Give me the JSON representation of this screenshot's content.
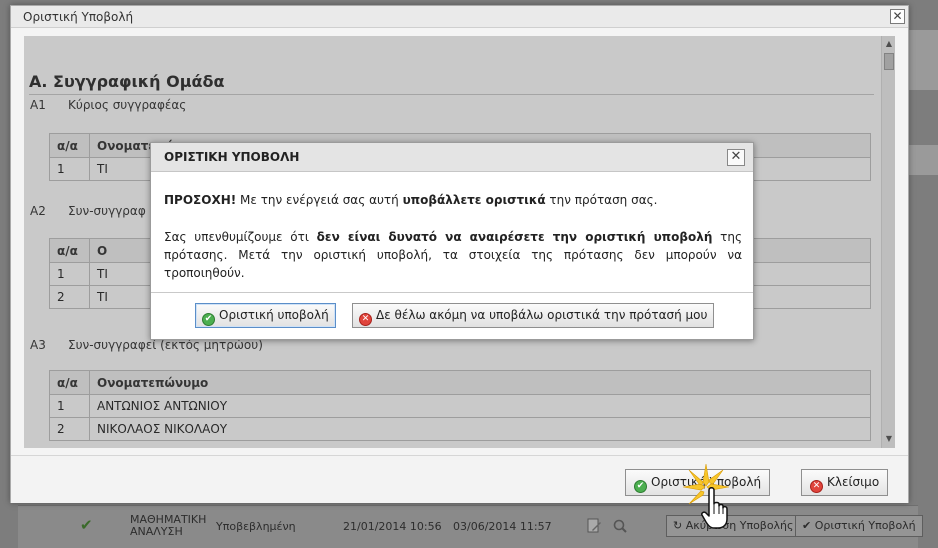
{
  "background": {
    "row": {
      "subject": "ΜΑΘΗΜΑΤΙΚΗ ΑΝΑΛΥΣΗ",
      "status": "Υποβεβλημένη",
      "date1": "21/01/2014 10:56",
      "date2": "03/06/2014 11:57",
      "btn_cancel": "Ακύρωση Υποβολής",
      "btn_submit": "Οριστική Υποβολή"
    }
  },
  "window": {
    "title": "Οριστική Υποβολή",
    "close_symbol": "✕",
    "section_title": "Α. Συγγραφική Ομάδα",
    "a1": {
      "code": "Α1",
      "label": "Κύριος συγγραφέας",
      "headers": [
        "α/α",
        "Ονοματεπώνυμο"
      ],
      "rows": [
        [
          "1",
          "ΤΙ"
        ]
      ]
    },
    "a2": {
      "code": "Α2",
      "label": "Συν-συγγραφ",
      "headers": [
        "α/α",
        "Ο"
      ],
      "rows": [
        [
          "1",
          "ΤΙ"
        ],
        [
          "2",
          "ΤΙ"
        ]
      ]
    },
    "a3": {
      "code": "Α3",
      "label": "Συν-συγγραφεί (εκτός μητρώου)",
      "headers": [
        "α/α",
        "Ονοματεπώνυμο"
      ],
      "rows": [
        [
          "1",
          "ΑΝΤΩΝΙΟΣ ΑΝΤΩΝΙΟΥ"
        ],
        [
          "2",
          "ΝΙΚΟΛΑΟΣ ΝΙΚΟΛΑΟΥ"
        ]
      ]
    },
    "footer": {
      "submit_label": "Οριστική Υποβολή",
      "close_label": "Κλείσιμο"
    }
  },
  "dialog": {
    "title": "ΟΡΙΣΤΙΚΗ ΥΠΟΒΟΛΗ",
    "close_symbol": "✕",
    "line1_strong": "ΠΡΟΣΟΧΗ!",
    "line1_a": " Με την ενέργειά σας αυτή ",
    "line1_bold": "υποβάλλετε οριστικά",
    "line1_b": " την πρόταση σας.",
    "line2_a": "Σας υπενθυμίζουμε ότι ",
    "line2_bold": "δεν είναι δυνατό να αναιρέσετε την οριστική υποβολή",
    "line2_b": " της πρότασης. Μετά την οριστική υποβολή, τα στοιχεία της πρότασης δεν μπορούν να τροποιηθούν.",
    "confirm_label": "Οριστική υποβολή",
    "decline_label": "Δε θέλω ακόμη να υποβάλω οριστικά την πρότασή μου"
  },
  "colors": {
    "confirm_icon": "#4caf50",
    "decline_icon": "#e0443c"
  }
}
